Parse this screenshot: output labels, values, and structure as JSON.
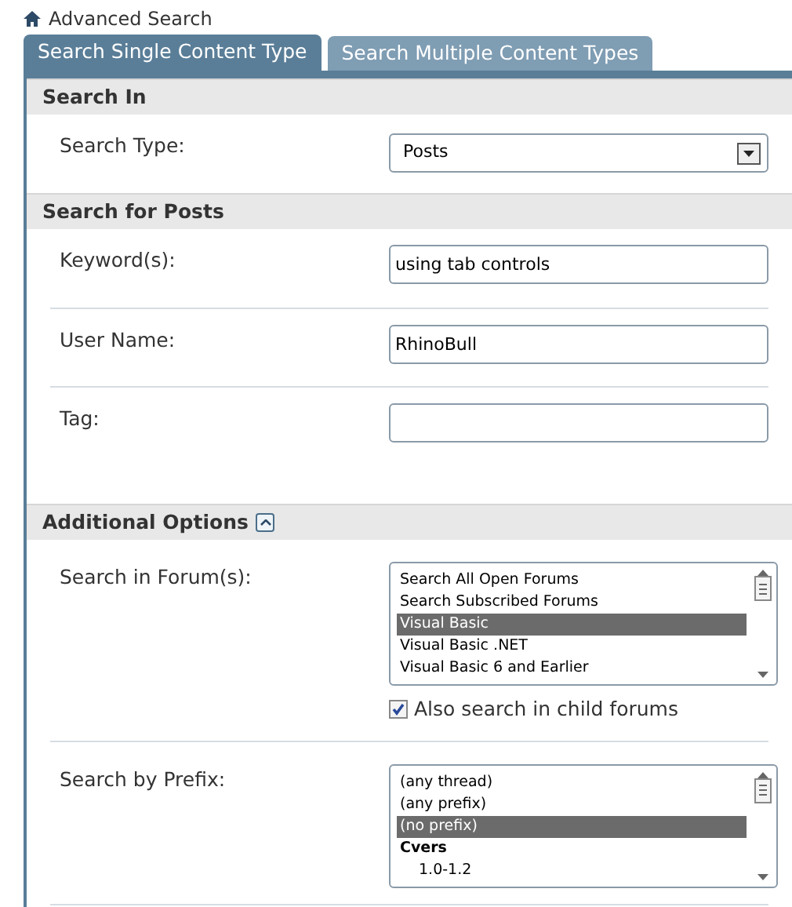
{
  "breadcrumb": "Advanced Search",
  "tabs": [
    {
      "label": "Search Single Content Type",
      "selected": true
    },
    {
      "label": "Search Multiple Content Types",
      "selected": false
    }
  ],
  "sections": [
    {
      "title": "Search In",
      "collapsible": false,
      "rows": [
        {
          "kind": "select",
          "label": "Search Type:",
          "value": "Posts"
        }
      ]
    },
    {
      "title": "Search for Posts",
      "collapsible": false,
      "rows": [
        {
          "kind": "text",
          "label": "Keyword(s):",
          "value": "using tab controls"
        },
        {
          "kind": "text",
          "label": "User Name:",
          "value": "RhinoBull"
        },
        {
          "kind": "text",
          "label": "Tag:",
          "value": "",
          "tall": true
        }
      ]
    },
    {
      "title": "Additional Options",
      "collapsible": true,
      "rows": [
        {
          "kind": "listbox",
          "label": "Search in Forum(s):",
          "options": [
            {
              "kind": "option",
              "label": "Search All Open Forums",
              "selected": false
            },
            {
              "kind": "option",
              "label": "Search Subscribed Forums",
              "selected": false
            },
            {
              "kind": "option",
              "label": "Visual Basic",
              "selected": true
            },
            {
              "kind": "option",
              "label": "Visual Basic .NET",
              "selected": false
            },
            {
              "kind": "option",
              "label": "Visual Basic 6 and Earlier",
              "selected": false
            }
          ],
          "checkbox": {
            "label": "Also search in child forums",
            "checked": true
          }
        },
        {
          "kind": "listbox",
          "label": "Search by Prefix:",
          "options": [
            {
              "kind": "option",
              "label": "(any thread)",
              "selected": false
            },
            {
              "kind": "option",
              "label": "(any prefix)",
              "selected": false
            },
            {
              "kind": "option",
              "label": "(no prefix)",
              "selected": true
            },
            {
              "kind": "group",
              "label": "Cvers",
              "selected": false
            },
            {
              "kind": "child",
              "label": "1.0-1.2",
              "selected": false
            }
          ]
        }
      ]
    }
  ]
}
